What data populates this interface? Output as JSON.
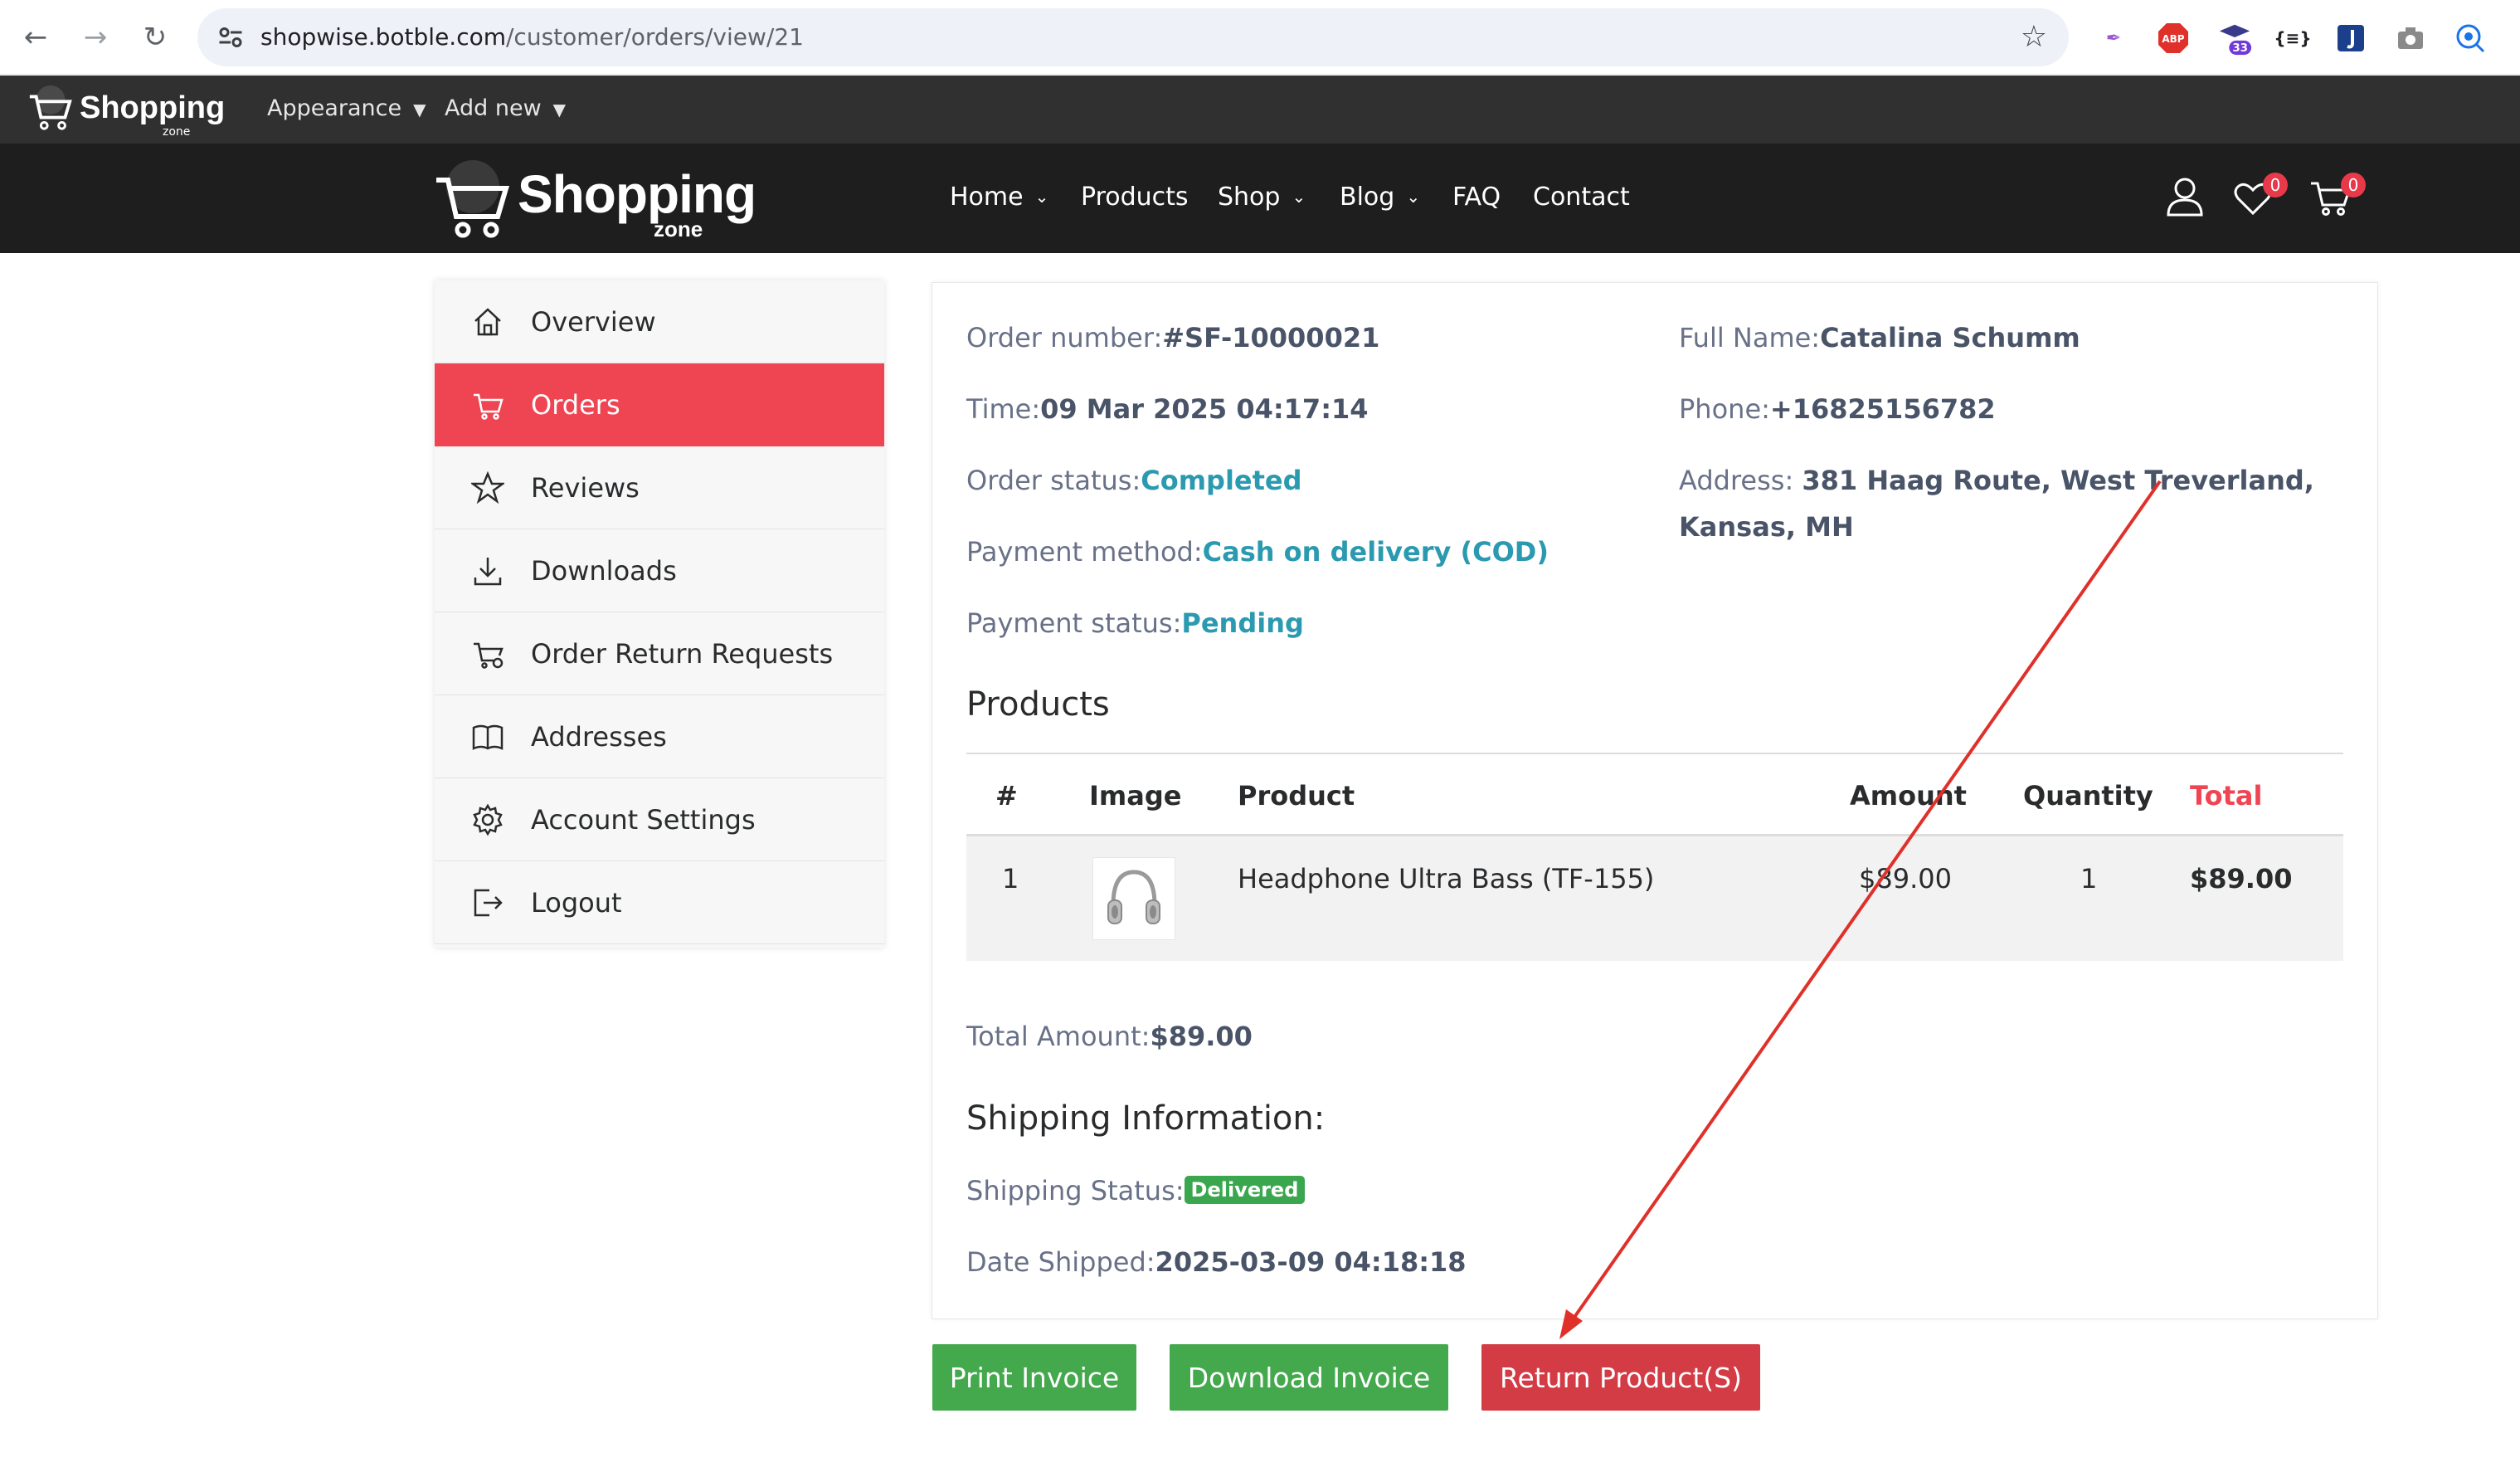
{
  "browser": {
    "url_host": "shopwise.botble.com",
    "url_path": "/customer/orders/view/21",
    "extension_badge": "33"
  },
  "adminbar": {
    "logo_text": "Shopping",
    "logo_sub": "zone",
    "menu": [
      {
        "label": "Appearance"
      },
      {
        "label": "Add new"
      }
    ]
  },
  "header": {
    "logo_text": "Shopping",
    "logo_sub": "zone",
    "nav": [
      {
        "label": "Home",
        "has_dropdown": true
      },
      {
        "label": "Products",
        "has_dropdown": false
      },
      {
        "label": "Shop",
        "has_dropdown": true
      },
      {
        "label": "Blog",
        "has_dropdown": true
      },
      {
        "label": "FAQ",
        "has_dropdown": false
      },
      {
        "label": "Contact",
        "has_dropdown": false
      }
    ],
    "wishlist_count": "0",
    "cart_count": "0"
  },
  "sidebar": {
    "items": [
      {
        "label": "Overview",
        "icon": "home-icon",
        "active": false
      },
      {
        "label": "Orders",
        "icon": "cart-icon",
        "active": true
      },
      {
        "label": "Reviews",
        "icon": "star-icon",
        "active": false
      },
      {
        "label": "Downloads",
        "icon": "download-icon",
        "active": false
      },
      {
        "label": "Order Return Requests",
        "icon": "cart-return-icon",
        "active": false
      },
      {
        "label": "Addresses",
        "icon": "book-icon",
        "active": false
      },
      {
        "label": "Account Settings",
        "icon": "gear-icon",
        "active": false
      },
      {
        "label": "Logout",
        "icon": "logout-icon",
        "active": false
      }
    ]
  },
  "order": {
    "number_label": "Order number:",
    "number": "#SF-10000021",
    "time_label": "Time:",
    "time": "09 Mar 2025 04:17:14",
    "status_label": "Order status:",
    "status": "Completed",
    "payment_method_label": "Payment method:",
    "payment_method": "Cash on delivery (COD)",
    "payment_status_label": "Payment status:",
    "payment_status": "Pending",
    "full_name_label": "Full Name:",
    "full_name": "Catalina Schumm",
    "phone_label": "Phone:",
    "phone": "+16825156782",
    "address_label": "Address: ",
    "address_line1": "381 Haag Route, West Treverland,",
    "address_line2": "Kansas, MH"
  },
  "products": {
    "title": "Products",
    "columns": [
      "#",
      "Image",
      "Product",
      "Amount",
      "Quantity",
      "Total"
    ],
    "rows": [
      {
        "index": "1",
        "image": "headphone-image",
        "product": "Headphone Ultra Bass (TF-155)",
        "amount": "$89.00",
        "quantity": "1",
        "total": "$89.00"
      }
    ]
  },
  "totals": {
    "total_label": "Total Amount:",
    "total": "$89.00"
  },
  "shipping": {
    "title": "Shipping Information:",
    "status_label": "Shipping Status:",
    "status": "Delivered",
    "date_label": "Date Shipped:",
    "date": "2025-03-09 04:18:18"
  },
  "actions": {
    "print": "Print Invoice",
    "download": "Download Invoice",
    "return": "Return Product(S)"
  },
  "colors": {
    "accent": "#ef4553",
    "teal": "#2b9ab0",
    "green": "#44a84d",
    "annotation_arrow": "#e0302a"
  }
}
